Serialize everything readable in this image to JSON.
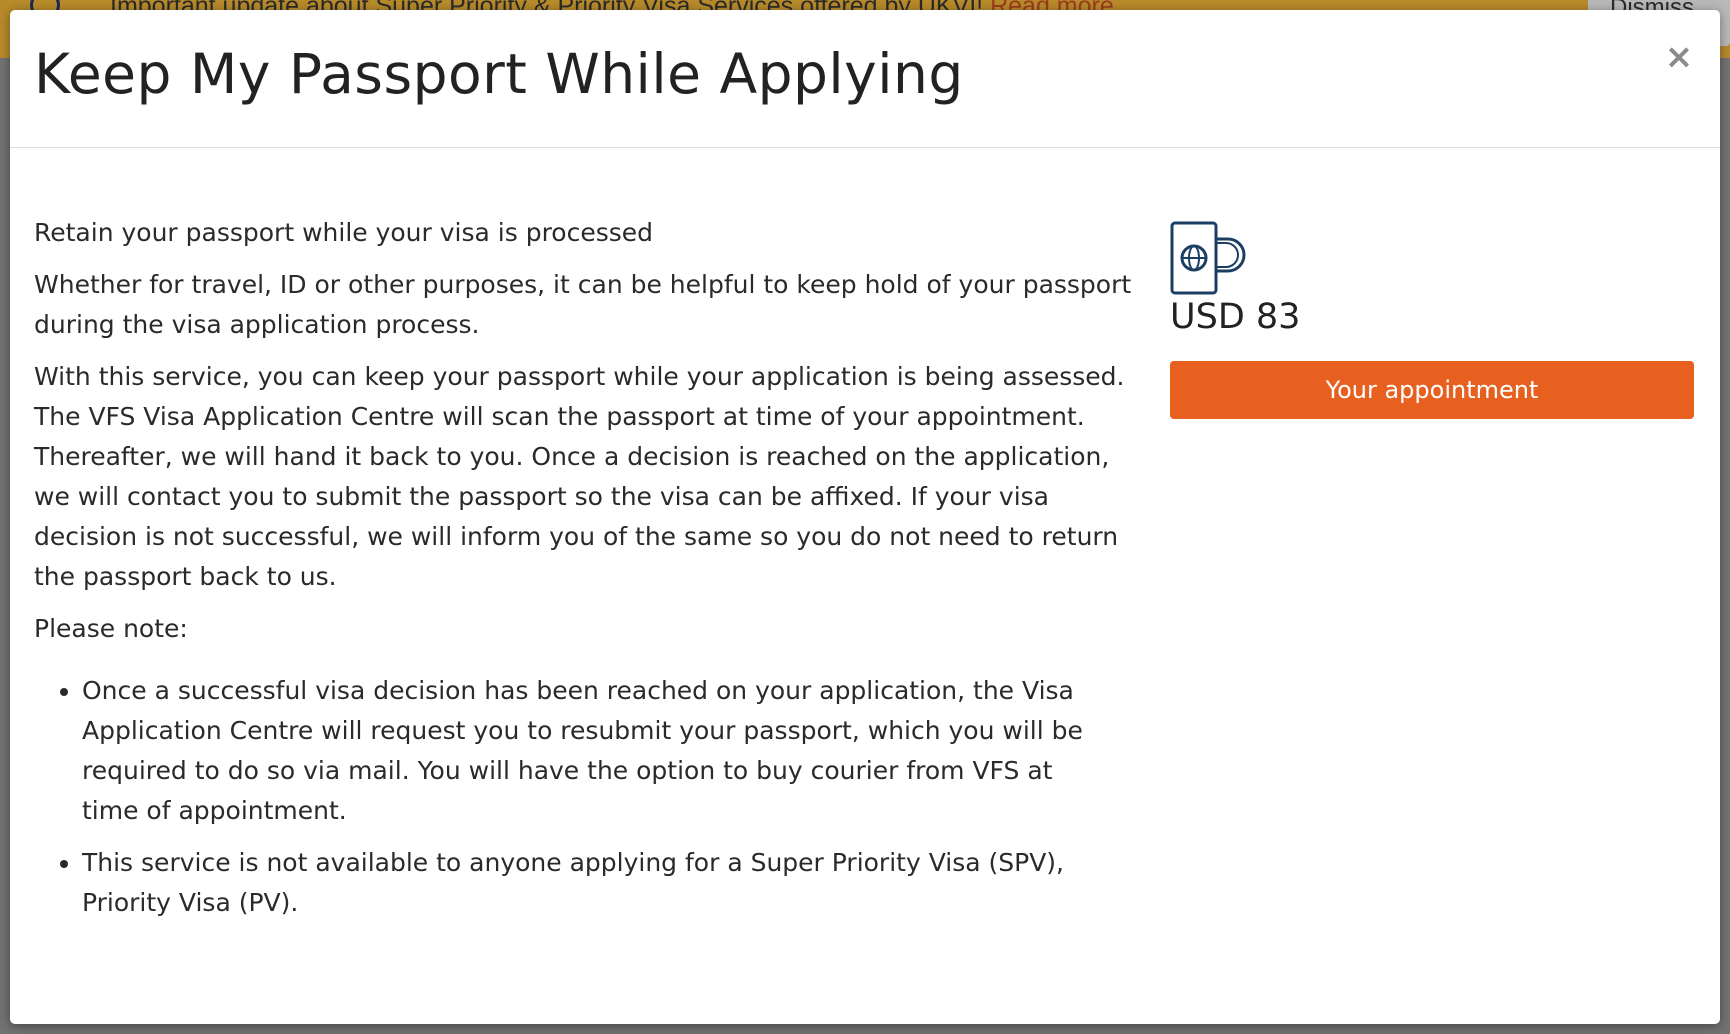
{
  "banner": {
    "text": "Important update about Super Priority & Priority Visa Services offered by UKVI",
    "link_label": "Read more",
    "dismiss_label": "Dismiss"
  },
  "modal": {
    "title": "Keep My Passport While Applying",
    "close_label": "×",
    "paragraphs": [
      "Retain your passport while your visa is processed",
      "Whether for travel, ID or other purposes, it can be helpful to keep hold of your passport during the visa application process.",
      "With this service, you can keep your passport while your application is being assessed. The VFS Visa Application Centre will scan the passport at time of your appointment. Thereafter, we will hand it back to you. Once a decision is reached on the application, we will contact you to submit the passport so the visa can be affixed. If your visa decision is not successful, we will inform you of the same so you do not need to return the passport back to us.",
      "Please note:"
    ],
    "notes": [
      "Once a successful visa decision has been reached on your application, the Visa Application Centre will request you to resubmit your passport, which you will be required to do so via mail. You will have the option to buy courier from VFS at time of appointment.",
      "This service is not available to anyone applying for a Super Priority Visa (SPV), Priority Visa (PV)."
    ],
    "price": "USD 83",
    "icon": "passport-icon",
    "button_label": "Your appointment"
  },
  "colors": {
    "accent": "#e8601f",
    "icon": "#1b3f63",
    "banner": "#b78a2a"
  }
}
